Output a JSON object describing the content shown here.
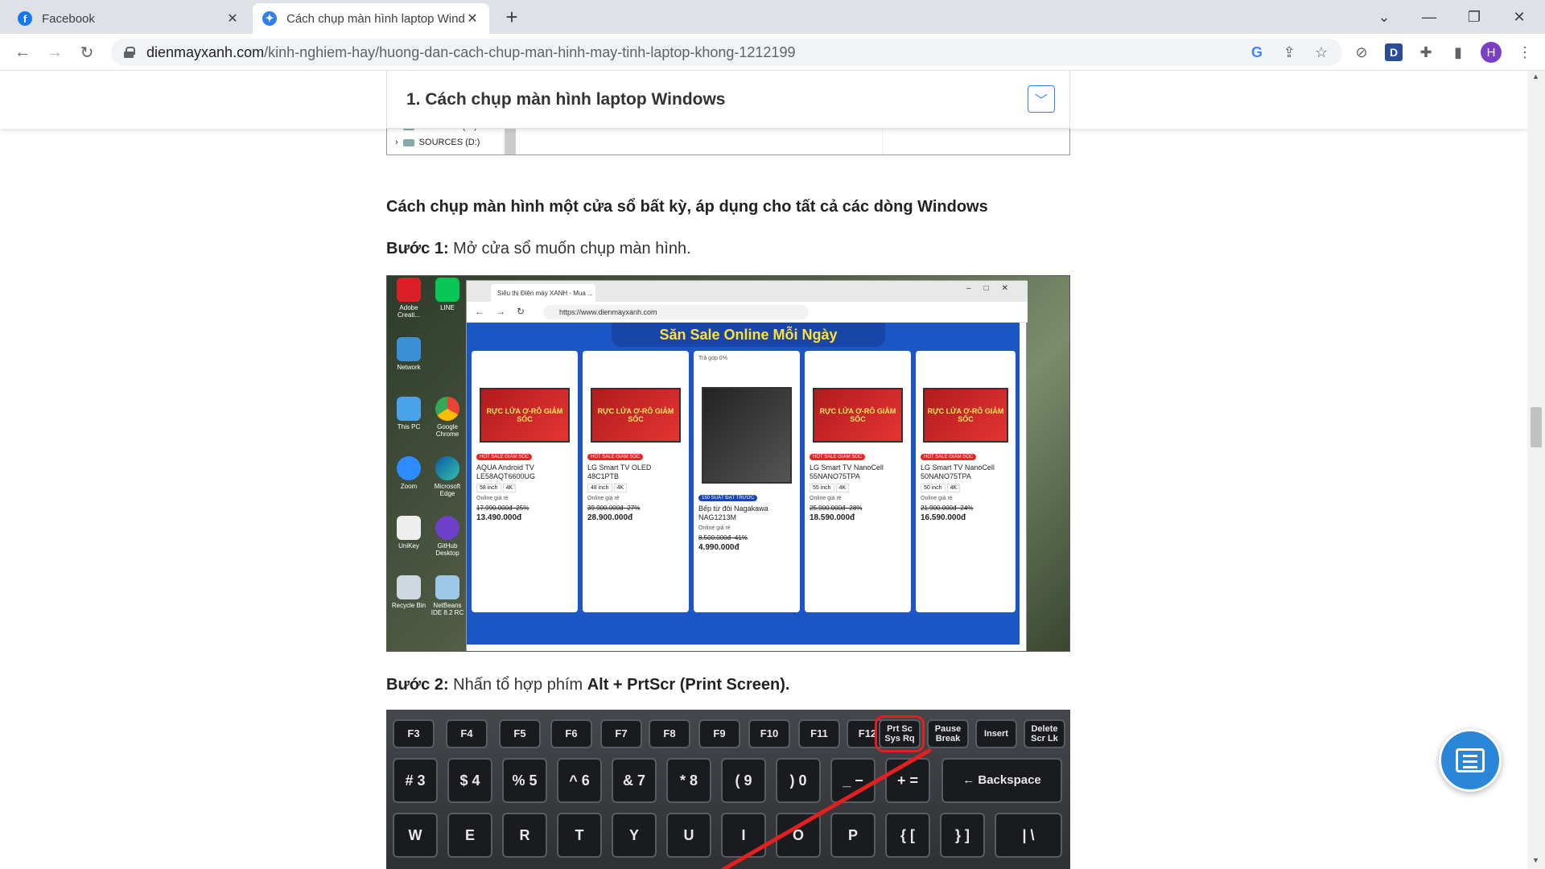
{
  "tabs": [
    {
      "title": "Facebook",
      "favicon": "facebook-icon",
      "color": "#1877f2"
    },
    {
      "title": "Cách chụp màn hình laptop Windows",
      "favicon": "dienmayxanh-icon",
      "color": "#2f80ed"
    }
  ],
  "url": {
    "host": "dienmayxanh.com",
    "path": "/kinh-nghiem-hay/huong-dan-cach-chup-man-hinh-may-tinh-laptop-khong-1212199"
  },
  "profile_initial": "H",
  "toc": {
    "title": "1. Cách chụp màn hình laptop Windows"
  },
  "explorer_snippet": {
    "items": [
      "Local Disk (C:)",
      "SOURCES (D:)"
    ]
  },
  "article": {
    "heading": "Cách chụp màn hình một cửa sổ bất kỳ, áp dụng cho tất cả các dòng Windows",
    "step1_label": "Bước 1:",
    "step1_text": " Mở cửa sổ muốn chụp màn hình.",
    "step2_label": "Bước 2:",
    "step2_text": " Nhấn tổ hợp phím ",
    "step2_keys": "Alt + PrtScr (Print Screen)."
  },
  "screenshot1": {
    "desktop_icons": [
      "Adobe Creati...",
      "LINE",
      "Network",
      "",
      "This PC",
      "Google Chrome",
      "Zoom",
      "Microsoft Edge",
      "UniKey",
      "GitHub Desktop",
      "Recycle Bin",
      "NetBeans IDE 8.2 RC"
    ],
    "browser_tab": "Siêu thị Điện máy XANH - Mua ...",
    "browser_url": "https://www.dienmayxanh.com",
    "banner": "Săn Sale Online Mỗi Ngày",
    "products": [
      {
        "img_text": "RỰC LỬA Ơ-RÔ GIẢM SỐC",
        "badge": "HOT SALE GIẢM SỐC",
        "name": "AQUA Android TV LE58AQT6600UG",
        "tags": [
          "58 inch",
          "4K"
        ],
        "label": "Online giá rẻ",
        "old": "17.990.000đ -25%",
        "new": "13.490.000đ"
      },
      {
        "img_text": "RỰC LỬA Ơ-RÔ GIẢM SỐC",
        "badge": "HOT SALE GIẢM SỐC",
        "name": "LG Smart TV OLED 48C1PTB",
        "tags": [
          "48 inch",
          "4K"
        ],
        "label": "Online giá rẻ",
        "old": "39.900.000đ -27%",
        "new": "28.900.000đ"
      },
      {
        "img_text": "",
        "badge": "150 SUẤT ĐẶT TRƯỚC",
        "name": "Bếp từ đôi Nagakawa NAG1213M",
        "tags": [],
        "label": "Online giá rẻ",
        "old": "8.500.000đ -41%",
        "new": "4.990.000đ",
        "note": "Trả góp 0%"
      },
      {
        "img_text": "RỰC LỬA Ơ-RÔ GIẢM SỐC",
        "badge": "HOT SALE GIẢM SỐC",
        "name": "LG Smart TV NanoCell 55NANO75TPA",
        "tags": [
          "55 inch",
          "4K"
        ],
        "label": "Online giá rẻ",
        "old": "25.900.000đ -28%",
        "new": "18.590.000đ"
      },
      {
        "img_text": "RỰC LỬA Ơ-RÔ GIẢM SỐC",
        "badge": "HOT SALE GIẢM SỐC",
        "name": "LG Smart TV NanoCell 50NANO75TPA",
        "tags": [
          "50 inch",
          "4K"
        ],
        "label": "Online giá rẻ",
        "old": "21.900.000đ -24%",
        "new": "16.590.000đ"
      }
    ]
  },
  "keyboard": {
    "fn_row": [
      "F3",
      "F4",
      "F5",
      "F6",
      "F7",
      "F8",
      "F9",
      "F10",
      "F11",
      "F12",
      "Prt Sc Sys Rq",
      "Pause Break",
      "Insert",
      "Delete Scr Lk"
    ],
    "num_row": [
      "# 3",
      "$ 4",
      "% 5",
      "^ 6",
      "& 7",
      "* 8",
      "( 9",
      ") 0",
      "_ −",
      "+ =",
      "← Backspace"
    ],
    "letter_row": [
      "W",
      "E",
      "R",
      "T",
      "Y",
      "U",
      "I",
      "O",
      "P",
      "{ [",
      "} ]",
      "| \\"
    ]
  }
}
